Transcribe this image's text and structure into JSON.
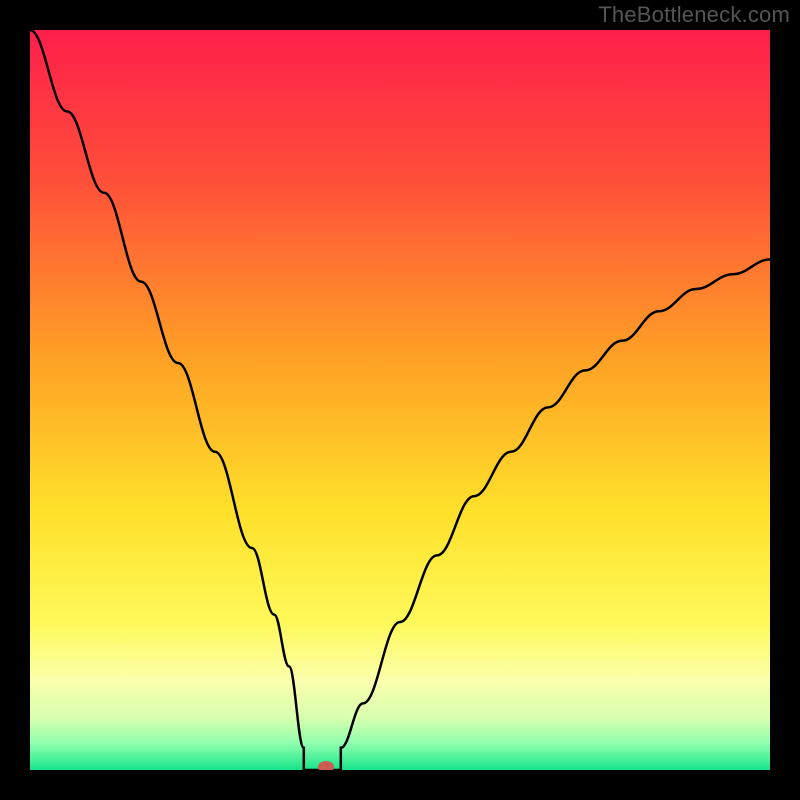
{
  "watermark": "TheBottleneck.com",
  "colors": {
    "page_bg": "#000000",
    "curve": "#000000",
    "marker": "#cc5b52",
    "gradient_stops": [
      {
        "offset": 0.0,
        "color": "#ff1f4b"
      },
      {
        "offset": 0.2,
        "color": "#ff4e3a"
      },
      {
        "offset": 0.45,
        "color": "#ffa325"
      },
      {
        "offset": 0.65,
        "color": "#ffe02a"
      },
      {
        "offset": 0.8,
        "color": "#fff95a"
      },
      {
        "offset": 0.88,
        "color": "#fbffad"
      },
      {
        "offset": 0.93,
        "color": "#d7ffb0"
      },
      {
        "offset": 0.965,
        "color": "#8dffad"
      },
      {
        "offset": 1.0,
        "color": "#17e48a"
      }
    ]
  },
  "chart_data": {
    "type": "line",
    "title": "",
    "xlabel": "",
    "ylabel": "",
    "xlim": [
      0,
      100
    ],
    "ylim": [
      0,
      100
    ],
    "marker": {
      "x": 40,
      "y": 0
    },
    "flat_segment": {
      "x_start": 37,
      "x_end": 42,
      "y": 0
    },
    "series": [
      {
        "name": "bottleneck-curve",
        "x": [
          0,
          5,
          10,
          15,
          20,
          25,
          30,
          33,
          35,
          37,
          42,
          45,
          50,
          55,
          60,
          65,
          70,
          75,
          80,
          85,
          90,
          95,
          100
        ],
        "y": [
          100,
          89,
          78,
          66,
          55,
          43,
          30,
          21,
          14,
          3,
          3,
          9,
          20,
          29,
          37,
          43,
          49,
          54,
          58,
          62,
          65,
          67,
          69
        ]
      }
    ]
  }
}
